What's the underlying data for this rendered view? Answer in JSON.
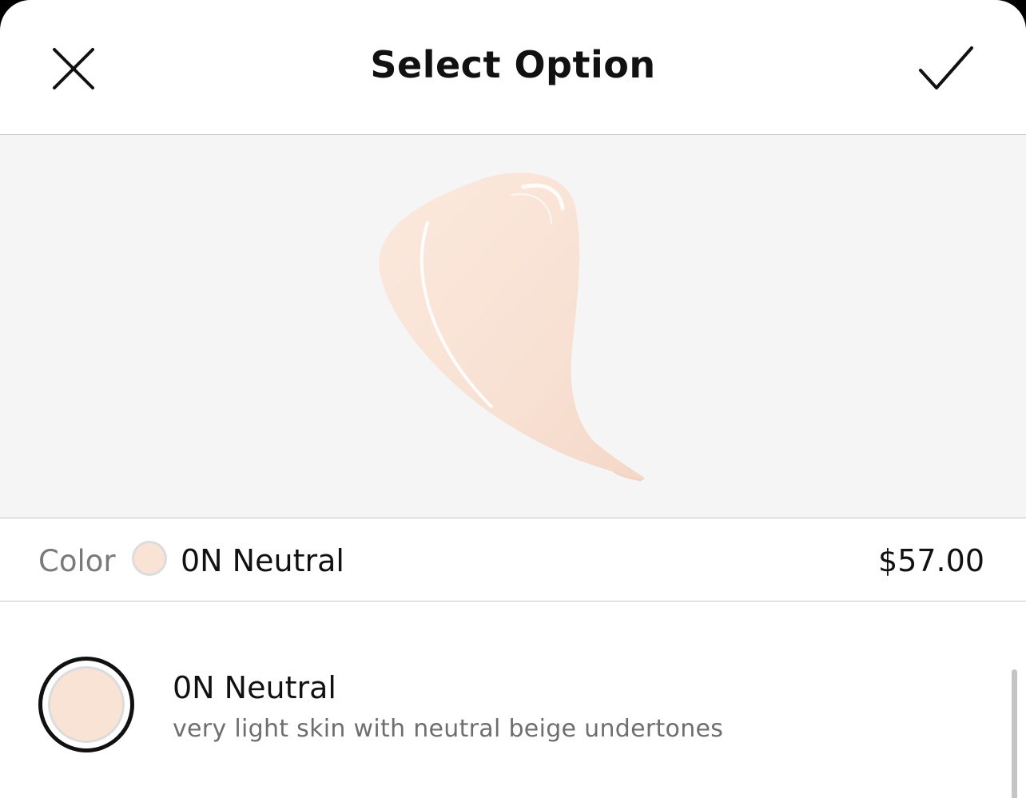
{
  "header": {
    "title": "Select Option",
    "close_icon": "close-icon",
    "confirm_icon": "checkmark-icon"
  },
  "preview": {
    "image": "foundation-swatch-smear"
  },
  "selection": {
    "label": "Color",
    "value": "0N Neutral",
    "price": "$57.00",
    "swatch_color": "#f9e3d5"
  },
  "options": [
    {
      "name": "0N Neutral",
      "description": "very light skin with neutral beige undertones",
      "swatch_color": "#f9e3d5",
      "selected": true
    }
  ],
  "colors": {
    "divider": "#c8c8c8",
    "preview_bg": "#f5f5f5",
    "text_primary": "#111111",
    "text_secondary": "#6e6e6e"
  }
}
